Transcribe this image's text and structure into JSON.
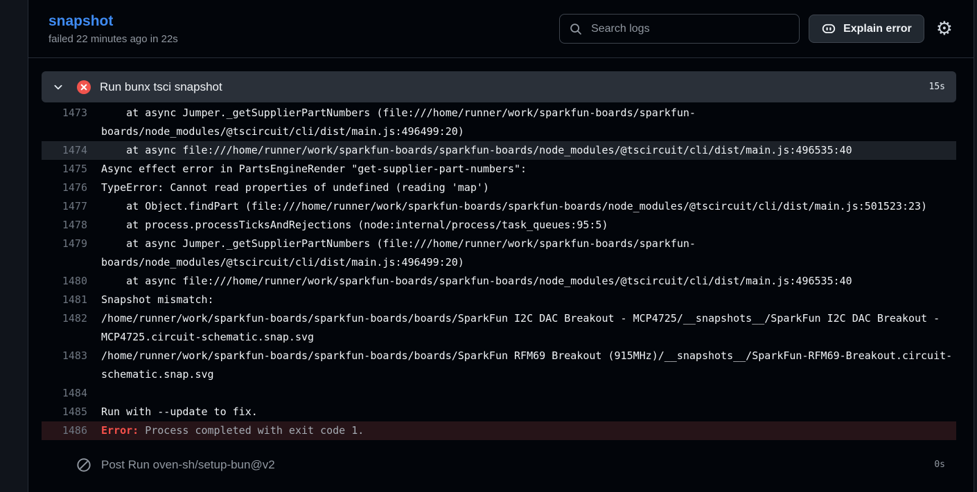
{
  "job": {
    "title": "snapshot",
    "status": "failed 22 minutes ago in 22s"
  },
  "toolbar": {
    "search_placeholder": "Search logs",
    "explain_label": "Explain error"
  },
  "step": {
    "title": "Run bunx tsci snapshot",
    "duration": "15s"
  },
  "post_step": {
    "title": "Post Run oven-sh/setup-bun@v2",
    "duration": "0s"
  },
  "icons": {
    "gear": "⚙"
  },
  "log": {
    "rows": [
      {
        "num": "1473",
        "text": "    at async Jumper._getSupplierPartNumbers (file:///home/runner/work/sparkfun-boards/sparkfun-"
      },
      {
        "num": "",
        "text": "boards/node_modules/@tscircuit/cli/dist/main.js:496499:20)"
      },
      {
        "num": "1474",
        "text": "    at async file:///home/runner/work/sparkfun-boards/sparkfun-boards/node_modules/@tscircuit/cli/dist/main.js:496535:40",
        "type": "highlight"
      },
      {
        "num": "1475",
        "text": "Async effect error in PartsEngineRender \"get-supplier-part-numbers\":"
      },
      {
        "num": "1476",
        "text": "TypeError: Cannot read properties of undefined (reading 'map')"
      },
      {
        "num": "1477",
        "text": "    at Object.findPart (file:///home/runner/work/sparkfun-boards/sparkfun-boards/node_modules/@tscircuit/cli/dist/main.js:501523:23)"
      },
      {
        "num": "1478",
        "text": "    at process.processTicksAndRejections (node:internal/process/task_queues:95:5)"
      },
      {
        "num": "1479",
        "text": "    at async Jumper._getSupplierPartNumbers (file:///home/runner/work/sparkfun-boards/sparkfun-"
      },
      {
        "num": "",
        "text": "boards/node_modules/@tscircuit/cli/dist/main.js:496499:20)"
      },
      {
        "num": "1480",
        "text": "    at async file:///home/runner/work/sparkfun-boards/sparkfun-boards/node_modules/@tscircuit/cli/dist/main.js:496535:40"
      },
      {
        "num": "1481",
        "text": "Snapshot mismatch:"
      },
      {
        "num": "1482",
        "text": "/home/runner/work/sparkfun-boards/sparkfun-boards/boards/SparkFun I2C DAC Breakout - MCP4725/__snapshots__/SparkFun I2C DAC Breakout -"
      },
      {
        "num": "",
        "text": "MCP4725.circuit-schematic.snap.svg"
      },
      {
        "num": "1483",
        "text": "/home/runner/work/sparkfun-boards/sparkfun-boards/boards/SparkFun RFM69 Breakout (915MHz)/__snapshots__/SparkFun-RFM69-Breakout.circuit-"
      },
      {
        "num": "",
        "text": "schematic.snap.svg"
      },
      {
        "num": "1484",
        "text": ""
      },
      {
        "num": "1485",
        "text": "Run with --update to fix."
      },
      {
        "num": "1486",
        "prefix": "Error:",
        "text": " Process completed with exit code 1.",
        "type": "error"
      }
    ]
  },
  "colors": {
    "accent_blue": "#3f8bf2",
    "panel_bg": "#02050a",
    "border": "#262c36",
    "muted": "#9198a1",
    "button_bg": "#212830",
    "control_border": "#3d444d",
    "step_header_bg": "#2a3039",
    "line_number": "#6e7681",
    "highlight_bg": "#1c2128",
    "error_bg": "#261418",
    "error_red": "#f8514b",
    "fail_icon_red": "#f1544d"
  }
}
